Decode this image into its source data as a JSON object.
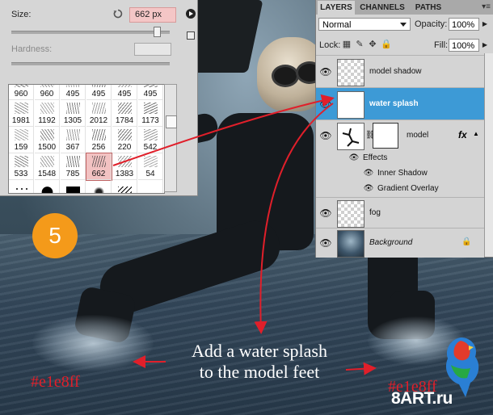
{
  "brush_panel": {
    "size_label": "Size:",
    "size_value": "662 px",
    "hardness_label": "Hardness:",
    "brush_numbers": [
      [
        "960",
        "960",
        "495",
        "495",
        "495",
        "495"
      ],
      [
        "1981",
        "1192",
        "1305",
        "2012",
        "1784",
        "1173"
      ],
      [
        "159",
        "1500",
        "367",
        "256",
        "220",
        "542"
      ],
      [
        "533",
        "1548",
        "785",
        "662",
        "1383",
        "54"
      ],
      [
        "",
        "",
        "",
        "",
        "",
        ""
      ]
    ],
    "selected_brush": "662"
  },
  "layers_panel": {
    "tabs": [
      "LAYERS",
      "CHANNELS",
      "PATHS"
    ],
    "blend_mode": "Normal",
    "opacity_label": "Opacity:",
    "opacity_value": "100%",
    "lock_label": "Lock:",
    "fill_label": "Fill:",
    "fill_value": "100%",
    "layers": [
      {
        "name": "model shadow"
      },
      {
        "name": "water splash"
      },
      {
        "name": "model"
      },
      {
        "name": "fog"
      },
      {
        "name": "Background"
      }
    ],
    "effects_label": "Effects",
    "effects": [
      "Inner Shadow",
      "Gradient Overlay"
    ],
    "fx_label": "fx"
  },
  "annotation": {
    "step_number": "5",
    "caption_line1": "Add a water splash",
    "caption_line2": "to the model feet",
    "color_code_left": "#e1e8ff",
    "color_code_right": "#e1e8ff",
    "arrow_color": "#e01f2a"
  },
  "watermark": "8ART.ru",
  "colors": {
    "selected_layer": "#3d9ad6",
    "step_badge": "#f49a1a",
    "size_field": "#f4c6c6"
  }
}
